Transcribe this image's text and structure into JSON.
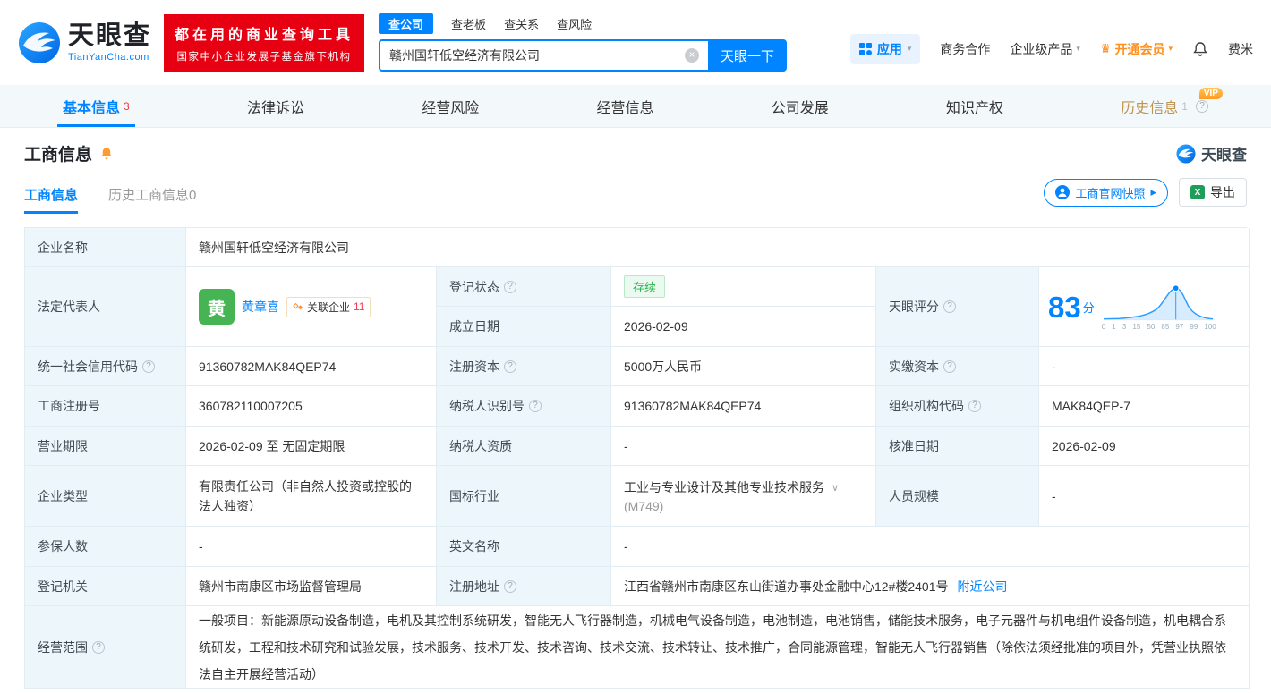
{
  "header": {
    "brand": "天眼查",
    "brand_domain": "TianYanCha.com",
    "slogan_line1": "都在用的商业查询工具",
    "slogan_line2": "国家中小企业发展子基金旗下机构",
    "search_tabs": {
      "company": "查公司",
      "boss": "查老板",
      "relation": "查关系",
      "risk": "查风险"
    },
    "search_value": "赣州国轩低空经济有限公司",
    "search_button": "天眼一下",
    "apps": "应用",
    "nav_cooperation": "商务合作",
    "nav_enterprise": "企业级产品",
    "nav_member": "开通会员",
    "nav_user": "费米"
  },
  "main_tabs": {
    "basic": {
      "label": "基本信息",
      "count": "3"
    },
    "legal": {
      "label": "法律诉讼"
    },
    "risk": {
      "label": "经营风险"
    },
    "operation": {
      "label": "经营信息"
    },
    "development": {
      "label": "公司发展"
    },
    "ip": {
      "label": "知识产权"
    },
    "history": {
      "label": "历史信息",
      "count": "1",
      "vip": "VIP"
    }
  },
  "section": {
    "title": "工商信息",
    "watermark": "天眼查",
    "subtab_current": "工商信息",
    "subtab_history": "历史工商信息0",
    "snapshot_button": "工商官网快照",
    "export_button": "导出"
  },
  "info": {
    "company_name": {
      "label": "企业名称",
      "value": "赣州国轩低空经济有限公司"
    },
    "legal_rep": {
      "label": "法定代表人",
      "avatar_char": "黄",
      "name": "黄章喜",
      "related_label": "关联企业",
      "related_count": "11"
    },
    "reg_status": {
      "label": "登记状态",
      "value": "存续"
    },
    "est_date": {
      "label": "成立日期",
      "value": "2026-02-09"
    },
    "score": {
      "label": "天眼评分",
      "value": "83",
      "unit": "分",
      "ticks": [
        "0",
        "1",
        "3",
        "15",
        "50",
        "85",
        "97",
        "99",
        "100"
      ]
    },
    "credit_code": {
      "label": "统一社会信用代码",
      "value": "91360782MAK84QEP74"
    },
    "reg_capital": {
      "label": "注册资本",
      "value": "5000万人民币"
    },
    "paid_capital": {
      "label": "实缴资本",
      "value": "-"
    },
    "reg_number": {
      "label": "工商注册号",
      "value": "360782110007205"
    },
    "taxpayer_id": {
      "label": "纳税人识别号",
      "value": "91360782MAK84QEP74"
    },
    "org_code": {
      "label": "组织机构代码",
      "value": "MAK84QEP-7"
    },
    "business_term": {
      "label": "营业期限",
      "value": "2026-02-09 至 无固定期限"
    },
    "taxpayer_qualification": {
      "label": "纳税人资质",
      "value": "-"
    },
    "approval_date": {
      "label": "核准日期",
      "value": "2026-02-09"
    },
    "company_type": {
      "label": "企业类型",
      "value": "有限责任公司（非自然人投资或控股的法人独资）"
    },
    "industry": {
      "label": "国标行业",
      "value": "工业与专业设计及其他专业技术服务",
      "code": "(M749)"
    },
    "staff_size": {
      "label": "人员规模",
      "value": "-"
    },
    "insured_count": {
      "label": "参保人数",
      "value": "-"
    },
    "english_name": {
      "label": "英文名称",
      "value": "-"
    },
    "reg_authority": {
      "label": "登记机关",
      "value": "赣州市南康区市场监督管理局"
    },
    "reg_address": {
      "label": "注册地址",
      "value": "江西省赣州市南康区东山街道办事处金融中心12#楼2401号",
      "link": "附近公司"
    },
    "business_scope": {
      "label": "经营范围",
      "value": "一般项目：新能源原动设备制造，电机及其控制系统研发，智能无人飞行器制造，机械电气设备制造，电池制造，电池销售，储能技术服务，电子元器件与机电组件设备制造，机电耦合系统研发，工程和技术研究和试验发展，技术服务、技术开发、技术咨询、技术交流、技术转让、技术推广，合同能源管理，智能无人飞行器销售（除依法须经批准的项目外，凭营业执照依法自主开展经营活动）"
    }
  },
  "icons": {
    "help": "?",
    "clear": "×",
    "caret_down": "▾",
    "chevron_down": "∨",
    "arrow_right": "▸",
    "crown": "♛",
    "excel": "X"
  }
}
